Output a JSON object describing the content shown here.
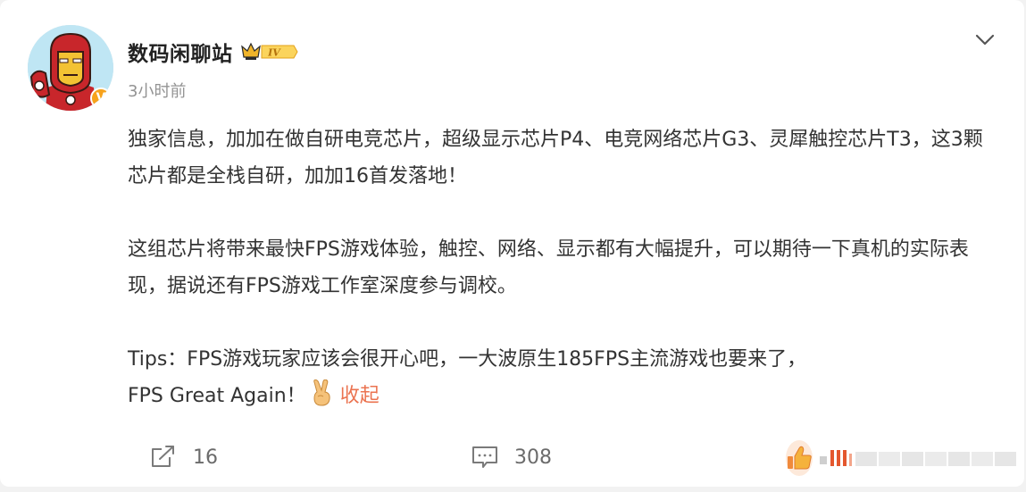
{
  "post": {
    "author": "数码闲聊站",
    "level_badge": "IV",
    "verified_badge": "V",
    "time": "3小时前",
    "paragraphs": [
      "独家信息，加加在做自研电竞芯片，超级显示芯片P4、电竞网络芯片G3、灵犀触控芯片T3，这3颗芯片都是全栈自研，加加16首发落地！",
      "这组芯片将带来最快FPS游戏体验，触控、网络、显示都有大幅提升，可以期待一下真机的实际表现，据说还有FPS游戏工作室深度参与调校。",
      "Tips：FPS游戏玩家应该会很开心吧，一大波原生185FPS主流游戏也要来了，"
    ],
    "last_line": "FPS Great Again！",
    "collapse_label": "收起"
  },
  "actions": {
    "repost_count": "16",
    "comment_count": "308"
  },
  "colors": {
    "accent": "#eb7350",
    "badge_orange": "#f7a21b",
    "text": "#333333",
    "muted": "#939393"
  },
  "icons": {
    "menu": "chevron-down-icon",
    "repost": "share-icon",
    "comment": "comment-icon",
    "like": "thumbs-up-icon",
    "emoji": "victory-hand-emoji"
  }
}
